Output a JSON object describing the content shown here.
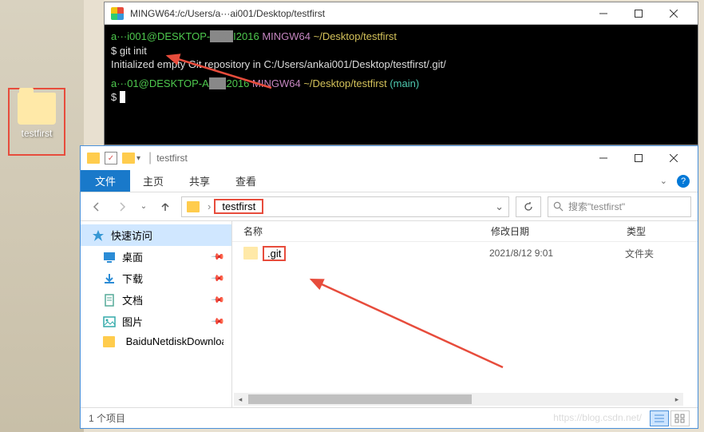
{
  "desktop": {
    "folder_name": "testfirst"
  },
  "terminal": {
    "title": "MINGW64:/c/Users/a···ai001/Desktop/testfirst",
    "user1a": "a···i001@DESKTOP-",
    "user1b": "I2016",
    "env": "MINGW64",
    "path": "~/Desktop/testfirst",
    "prompt": "$",
    "cmd1": "git init",
    "out1": "Initialized empty Git repository in C:/Users/ankai001/Desktop/testfirst/.git/",
    "user2a": "a···01@DESKTOP-A",
    "user2b": "2016",
    "branch": "(main)"
  },
  "explorer": {
    "title_text": "testfirst",
    "ribbon": {
      "file": "文件",
      "home": "主页",
      "share": "共享",
      "view": "查看"
    },
    "nav": {
      "addr": "testfirst",
      "search_placeholder": "搜索\"testfirst\""
    },
    "sidebar": {
      "quick": "快速访问",
      "items": [
        {
          "label": "桌面"
        },
        {
          "label": "下载"
        },
        {
          "label": "文档"
        },
        {
          "label": "图片"
        },
        {
          "label": "BaiduNetdiskDownload"
        }
      ]
    },
    "columns": {
      "name": "名称",
      "date": "修改日期",
      "type": "类型"
    },
    "files": [
      {
        "name": ".git",
        "date": "2021/8/12 9:01",
        "type": "文件夹"
      }
    ],
    "status": "1 个项目",
    "watermark": "https://blog.csdn.net/"
  }
}
